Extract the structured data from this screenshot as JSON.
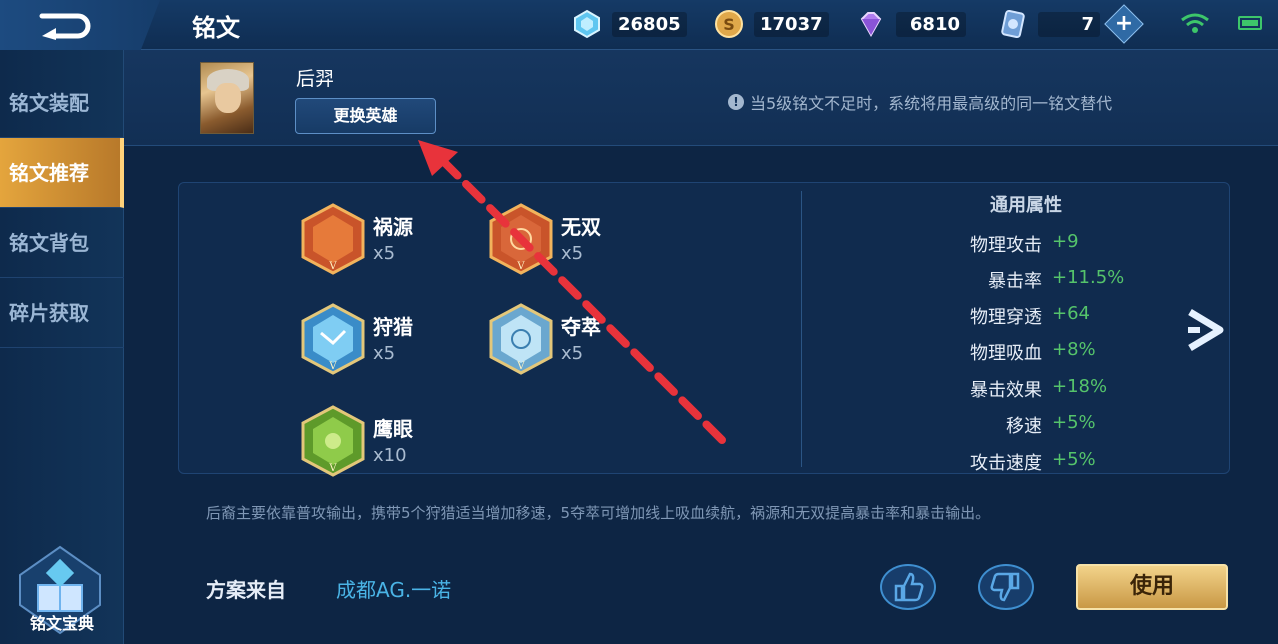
{
  "header": {
    "title": "铭文",
    "resources": [
      {
        "icon": "diamond-crystal-icon",
        "value": "26805"
      },
      {
        "icon": "gold-coin-icon",
        "value": "17037"
      },
      {
        "icon": "purple-gem-icon",
        "value": "6810"
      },
      {
        "icon": "ticket-card-icon",
        "value": "7"
      }
    ]
  },
  "sidebar": {
    "items": [
      {
        "label": "铭文装配",
        "active": false
      },
      {
        "label": "铭文推荐",
        "active": true
      },
      {
        "label": "铭文背包",
        "active": false
      },
      {
        "label": "碎片获取",
        "active": false
      }
    ],
    "codex_label": "铭文宝典"
  },
  "hero": {
    "name": "后羿",
    "change_button": "更换英雄",
    "notice": "当5级铭文不足时，系统将用最高级的同一铭文替代"
  },
  "runes": [
    {
      "name": "祸源",
      "count": "x5",
      "color": "red"
    },
    {
      "name": "无双",
      "count": "x5",
      "color": "red"
    },
    {
      "name": "狩猎",
      "count": "x5",
      "color": "blue"
    },
    {
      "name": "夺萃",
      "count": "x5",
      "color": "blue"
    },
    {
      "name": "鹰眼",
      "count": "x10",
      "color": "green"
    }
  ],
  "attributes": {
    "title": "通用属性",
    "rows": [
      {
        "name": "物理攻击",
        "value": "+9"
      },
      {
        "name": "暴击率",
        "value": "+11.5%"
      },
      {
        "name": "物理穿透",
        "value": "+64"
      },
      {
        "name": "物理吸血",
        "value": "+8%"
      },
      {
        "name": "暴击效果",
        "value": "+18%"
      },
      {
        "name": "移速",
        "value": "+5%"
      },
      {
        "name": "攻击速度",
        "value": "+5%"
      }
    ]
  },
  "description": "后裔主要依靠普攻输出，携带5个狩猎适当增加移速，5夺萃可增加线上吸血续航，祸源和无双提高暴击率和暴击输出。",
  "source": {
    "label": "方案来自",
    "author": "成都AG.一诺"
  },
  "actions": {
    "use_label": "使用"
  },
  "colors": {
    "accent_gold": "#e4a53d",
    "value_green": "#55c46b",
    "author_blue": "#4ab4e6",
    "annotation_red": "#e8333b"
  }
}
